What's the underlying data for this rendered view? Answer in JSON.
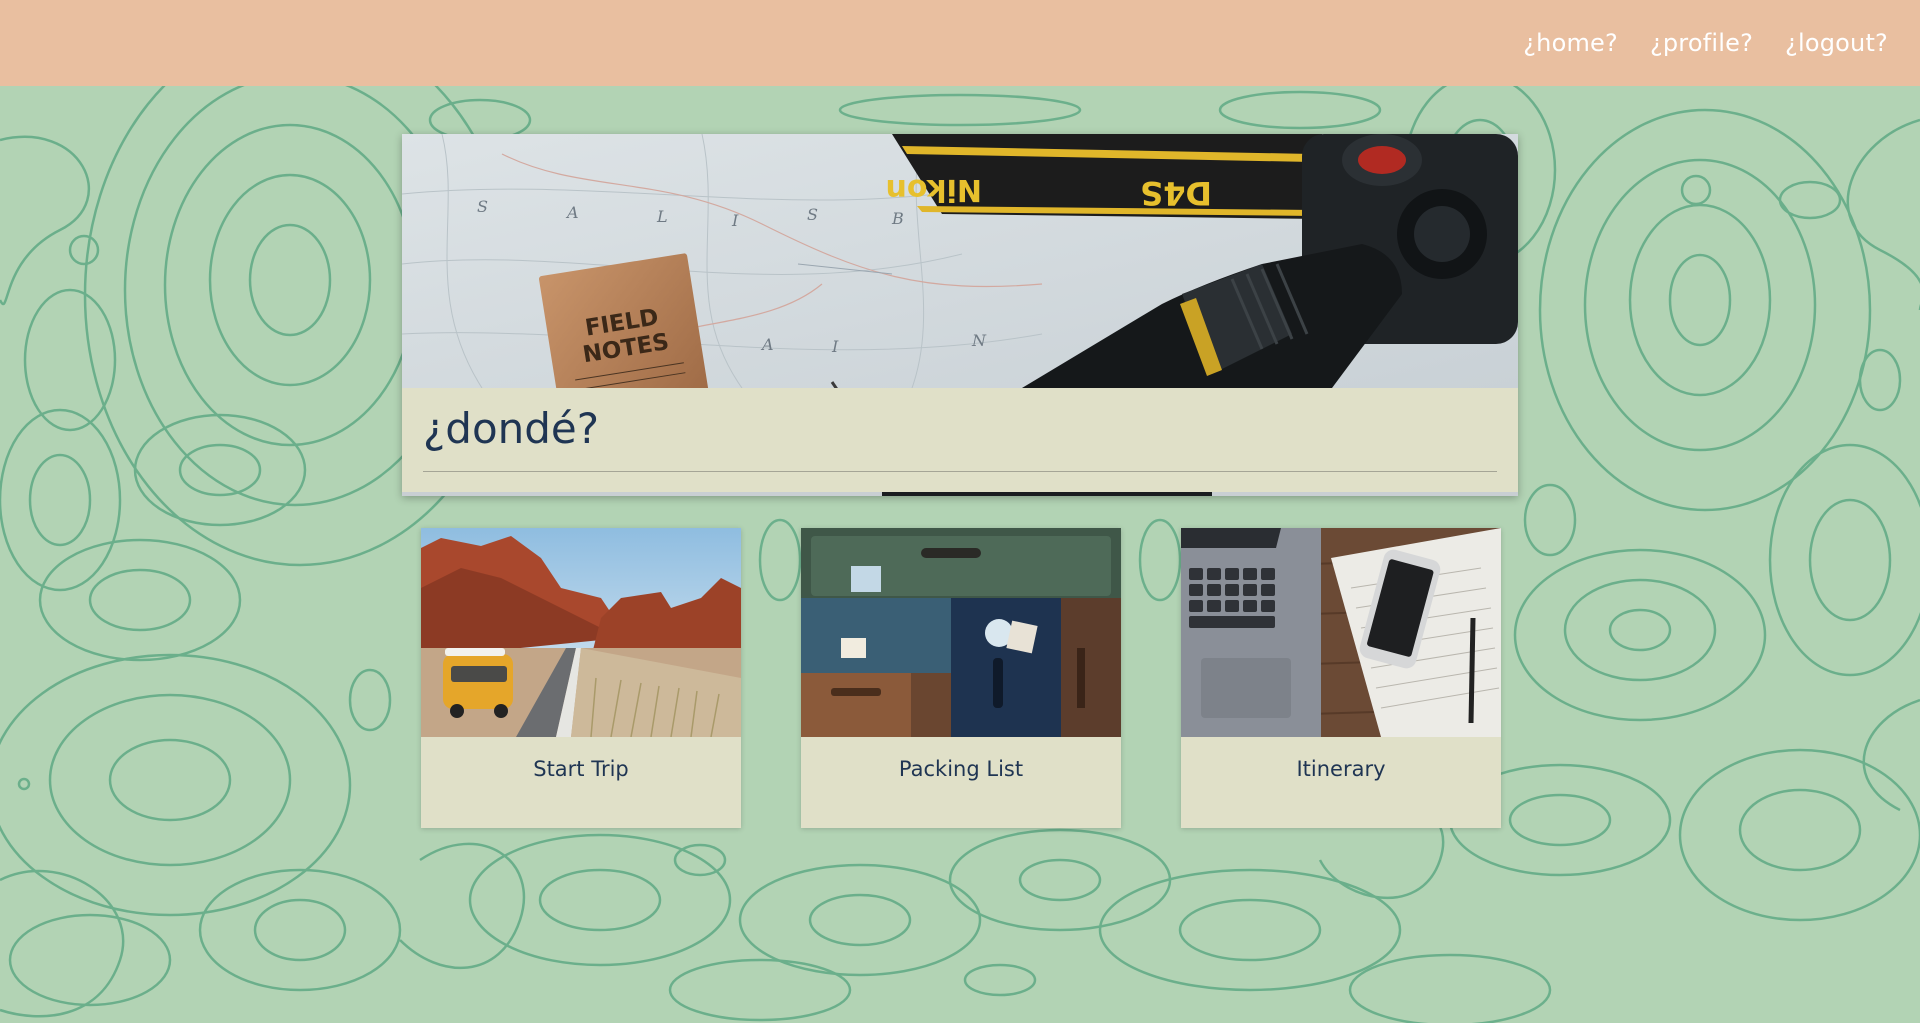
{
  "nav": {
    "links": [
      {
        "label": "¿home?"
      },
      {
        "label": "¿profile?"
      },
      {
        "label": "¿logout?"
      }
    ]
  },
  "hero": {
    "title": "¿dondé?",
    "image_notebook_text": "FIELD NOTES",
    "image_strap_text": "Nikon",
    "image_strap_model": "D4S"
  },
  "cards": [
    {
      "label": "Start Trip",
      "image": "van-desert-road"
    },
    {
      "label": "Packing List",
      "image": "stacked-suitcases"
    },
    {
      "label": "Itinerary",
      "image": "laptop-phone-notebook"
    }
  ],
  "colors": {
    "navbar": "#e9bfa0",
    "background": "#b2d3b4",
    "topo_line": "#5fa985",
    "card": "#e0e0c8",
    "text": "#1f3553"
  }
}
